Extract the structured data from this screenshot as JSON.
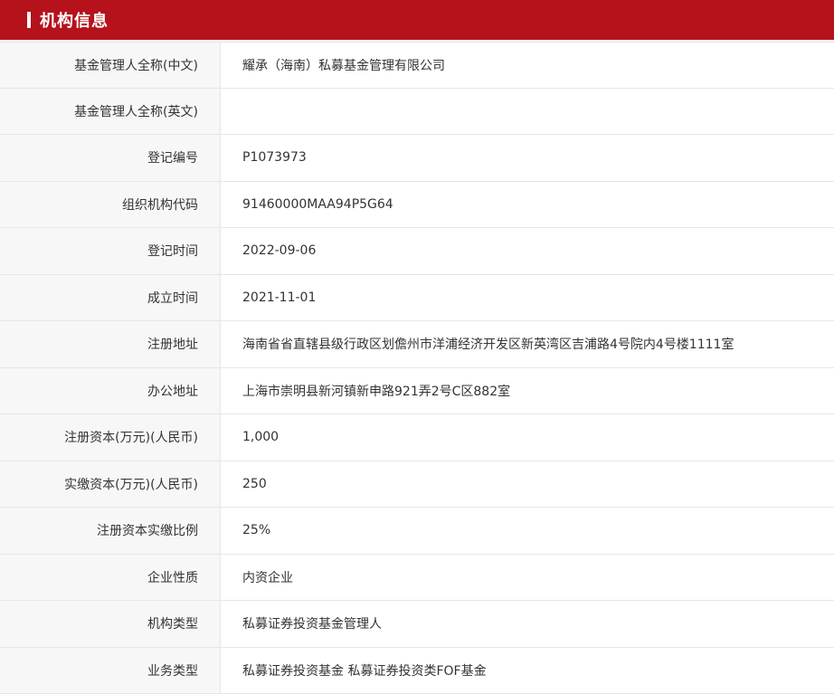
{
  "header": {
    "title": "机构信息"
  },
  "colors": {
    "header_bg": "#b5121b",
    "label_bg": "#f7f7f7",
    "border": "#e6e6e6",
    "text": "#333333"
  },
  "rows": [
    {
      "label": "基金管理人全称(中文)",
      "value": "耀承（海南）私募基金管理有限公司"
    },
    {
      "label": "基金管理人全称(英文)",
      "value": ""
    },
    {
      "label": "登记编号",
      "value": "P1073973"
    },
    {
      "label": "组织机构代码",
      "value": "91460000MAA94P5G64"
    },
    {
      "label": "登记时间",
      "value": "2022-09-06"
    },
    {
      "label": "成立时间",
      "value": "2021-11-01"
    },
    {
      "label": "注册地址",
      "value": "海南省省直辖县级行政区划儋州市洋浦经济开发区新英湾区吉浦路4号院内4号楼1111室"
    },
    {
      "label": "办公地址",
      "value": "上海市崇明县新河镇新申路921弄2号C区882室"
    },
    {
      "label": "注册资本(万元)(人民币)",
      "value": "1,000"
    },
    {
      "label": "实缴资本(万元)(人民币)",
      "value": "250"
    },
    {
      "label": "注册资本实缴比例",
      "value": "25%"
    },
    {
      "label": "企业性质",
      "value": "内资企业"
    },
    {
      "label": "机构类型",
      "value": "私募证券投资基金管理人"
    },
    {
      "label": "业务类型",
      "value": "私募证券投资基金  私募证券投资类FOF基金"
    }
  ]
}
